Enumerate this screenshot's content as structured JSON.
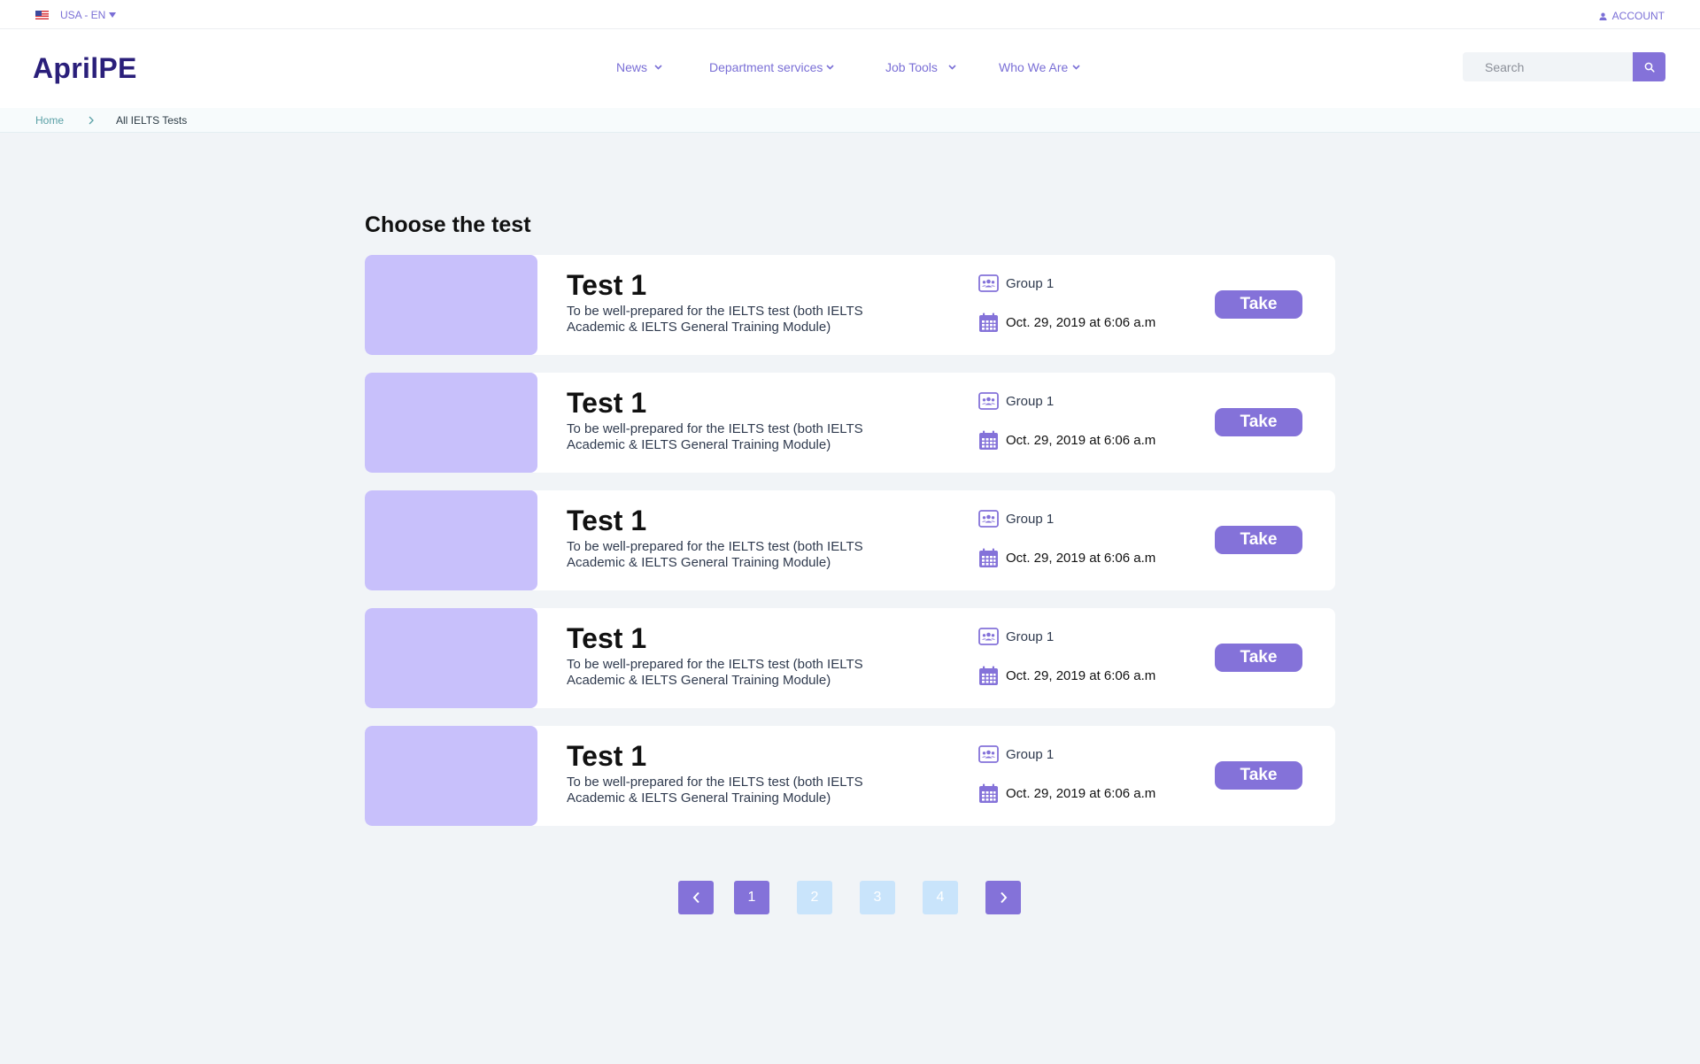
{
  "topbar": {
    "locale_label": "USA - EN",
    "account_label": "ACCOUNT"
  },
  "header": {
    "logo": "AprilPE",
    "nav": [
      {
        "label": "News"
      },
      {
        "label": "Department services"
      },
      {
        "label": "Job Tools"
      },
      {
        "label": "Who We Are"
      }
    ],
    "search_placeholder": "Search"
  },
  "breadcrumb": {
    "home": "Home",
    "current": "All IELTS Tests"
  },
  "main": {
    "title": "Choose the test",
    "tests": [
      {
        "title": "Test 1",
        "description": "To be well-prepared for the IELTS test (both IELTS Academic & IELTS General Training Module)",
        "group": "Group 1",
        "date": "Oct. 29, 2019 at 6:06 a.m",
        "action": "Take"
      },
      {
        "title": "Test 1",
        "description": "To be well-prepared for the IELTS test (both IELTS Academic & IELTS General Training Module)",
        "group": "Group 1",
        "date": "Oct. 29, 2019 at 6:06 a.m",
        "action": "Take"
      },
      {
        "title": "Test 1",
        "description": "To be well-prepared for the IELTS test (both IELTS Academic & IELTS General Training Module)",
        "group": "Group 1",
        "date": "Oct. 29, 2019 at 6:06 a.m",
        "action": "Take"
      },
      {
        "title": "Test 1",
        "description": "To be well-prepared for the IELTS test (both IELTS Academic & IELTS General Training Module)",
        "group": "Group 1",
        "date": "Oct. 29, 2019 at 6:06 a.m",
        "action": "Take"
      },
      {
        "title": "Test 1",
        "description": "To be well-prepared for the IELTS test (both IELTS Academic & IELTS General Training Module)",
        "group": "Group 1",
        "date": "Oct. 29, 2019 at 6:06 a.m",
        "action": "Take"
      }
    ]
  },
  "pagination": {
    "pages": [
      "1",
      "2",
      "3",
      "4"
    ],
    "current_page": "1"
  },
  "colors": {
    "accent": "#8472d9",
    "logo": "#2a1f7a",
    "thumbnail": "#c8c0fb",
    "page_idle": "#c9e4fb",
    "background": "#f1f4f7"
  },
  "icons": {
    "flag": "us-flag-icon",
    "account": "user-icon",
    "search": "search-icon",
    "group": "group-icon",
    "date": "calendar-icon",
    "prev": "chevron-left-icon",
    "next": "chevron-right-icon"
  }
}
